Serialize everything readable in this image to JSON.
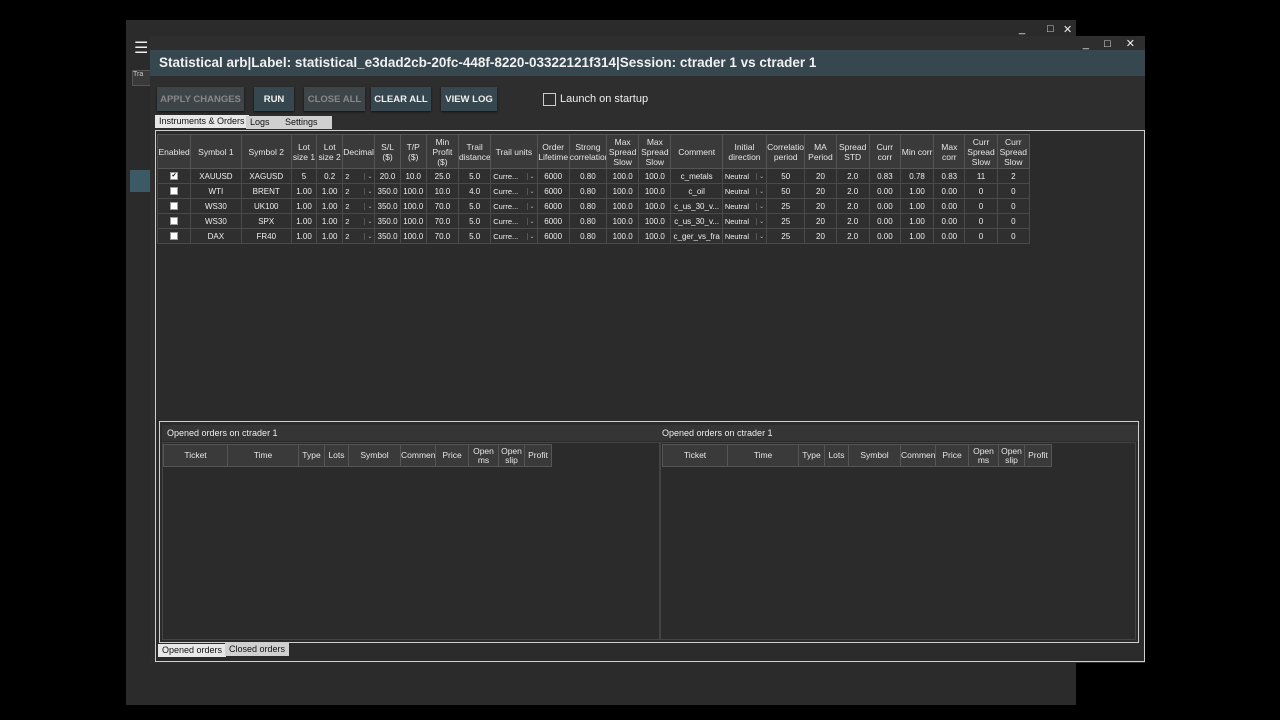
{
  "window": {
    "title": "Statistical arb|Label: statistical_e3dad2cb-20fc-448f-8220-03322121f314|Session: ctrader 1 vs ctrader 1",
    "controls": [
      "_",
      "□",
      "✕"
    ]
  },
  "background_window": {
    "controls": [
      "_",
      "□",
      "✕"
    ],
    "menu_icon": "hamburger-icon",
    "side_tab": "Tra"
  },
  "toolbar": {
    "apply_changes": "APPLY CHANGES",
    "run": "RUN",
    "close_all": "CLOSE ALL",
    "clear_all": "CLEAR ALL",
    "view_log": "VIEW LOG",
    "launch_on_startup": "Launch on startup"
  },
  "tabs": {
    "instruments": "Instruments & Orders",
    "logs": "Logs",
    "settings": "Settings"
  },
  "instruments_table": {
    "headers": [
      "Enabled",
      "Symbol 1",
      "Symbol 2",
      "Lot size 1",
      "Lot size 2",
      "Decimals",
      "S/L ($)",
      "T/P ($)",
      "Min Profit ($)",
      "Trail distance",
      "Trail units",
      "Order Lifetime",
      "Strong correlation",
      "Max Spread Slow",
      "Max Spread Slow",
      "Comment",
      "Initial direction",
      "Correlation period",
      "MA Period",
      "Spread STD",
      "Curr corr",
      "Min corr",
      "Max corr",
      "Curr Spread Slow",
      "Curr Spread Slow"
    ],
    "rows": [
      {
        "enabled": "✔",
        "sym1": "XAUUSD",
        "sym2": "XAGUSD",
        "lot1": "5",
        "lot2": "0.2",
        "dec": "2",
        "sl": "20.0",
        "tp": "10.0",
        "minp": "25.0",
        "trail": "5.0",
        "units": "Curre...",
        "life": "6000",
        "strong": "0.80",
        "ms1": "100.0",
        "ms2": "100.0",
        "comment": "c_metals",
        "dir": "Neutral",
        "cp": "50",
        "ma": "20",
        "std": "2.0",
        "cc": "0.83",
        "minc": "0.78",
        "maxc": "0.83",
        "cs1": "11",
        "cs2": "2"
      },
      {
        "enabled": "",
        "sym1": "WTI",
        "sym2": "BRENT",
        "lot1": "1.00",
        "lot2": "1.00",
        "dec": "2",
        "sl": "350.0",
        "tp": "100.0",
        "minp": "10.0",
        "trail": "4.0",
        "units": "Curre...",
        "life": "6000",
        "strong": "0.80",
        "ms1": "100.0",
        "ms2": "100.0",
        "comment": "c_oil",
        "dir": "Neutral",
        "cp": "50",
        "ma": "20",
        "std": "2.0",
        "cc": "0.00",
        "minc": "1.00",
        "maxc": "0.00",
        "cs1": "0",
        "cs2": "0"
      },
      {
        "enabled": "",
        "sym1": "WS30",
        "sym2": "UK100",
        "lot1": "1.00",
        "lot2": "1.00",
        "dec": "2",
        "sl": "350.0",
        "tp": "100.0",
        "minp": "70.0",
        "trail": "5.0",
        "units": "Curre...",
        "life": "6000",
        "strong": "0.80",
        "ms1": "100.0",
        "ms2": "100.0",
        "comment": "c_us_30_v...",
        "dir": "Neutral",
        "cp": "25",
        "ma": "20",
        "std": "2.0",
        "cc": "0.00",
        "minc": "1.00",
        "maxc": "0.00",
        "cs1": "0",
        "cs2": "0"
      },
      {
        "enabled": "",
        "sym1": "WS30",
        "sym2": "SPX",
        "lot1": "1.00",
        "lot2": "1.00",
        "dec": "2",
        "sl": "350.0",
        "tp": "100.0",
        "minp": "70.0",
        "trail": "5.0",
        "units": "Curre...",
        "life": "6000",
        "strong": "0.80",
        "ms1": "100.0",
        "ms2": "100.0",
        "comment": "c_us_30_v...",
        "dir": "Neutral",
        "cp": "25",
        "ma": "20",
        "std": "2.0",
        "cc": "0.00",
        "minc": "1.00",
        "maxc": "0.00",
        "cs1": "0",
        "cs2": "0"
      },
      {
        "enabled": "",
        "sym1": "DAX",
        "sym2": "FR40",
        "lot1": "1.00",
        "lot2": "1.00",
        "dec": "2",
        "sl": "350.0",
        "tp": "100.0",
        "minp": "70.0",
        "trail": "5.0",
        "units": "Curre...",
        "life": "6000",
        "strong": "0.80",
        "ms1": "100.0",
        "ms2": "100.0",
        "comment": "c_ger_vs_fra",
        "dir": "Neutral",
        "cp": "25",
        "ma": "20",
        "std": "2.0",
        "cc": "0.00",
        "minc": "1.00",
        "maxc": "0.00",
        "cs1": "0",
        "cs2": "0"
      }
    ]
  },
  "orders": {
    "left_title": "Opened orders on  ctrader 1",
    "right_title": "Opened orders on  ctrader 1",
    "headers": [
      "Ticket",
      "Time",
      "Type",
      "Lots",
      "Symbol",
      "Comment",
      "Price",
      "Open ms",
      "Open slip",
      "Profit"
    ]
  },
  "bottom_tabs": {
    "opened": "Opened orders",
    "closed": "Closed orders"
  }
}
